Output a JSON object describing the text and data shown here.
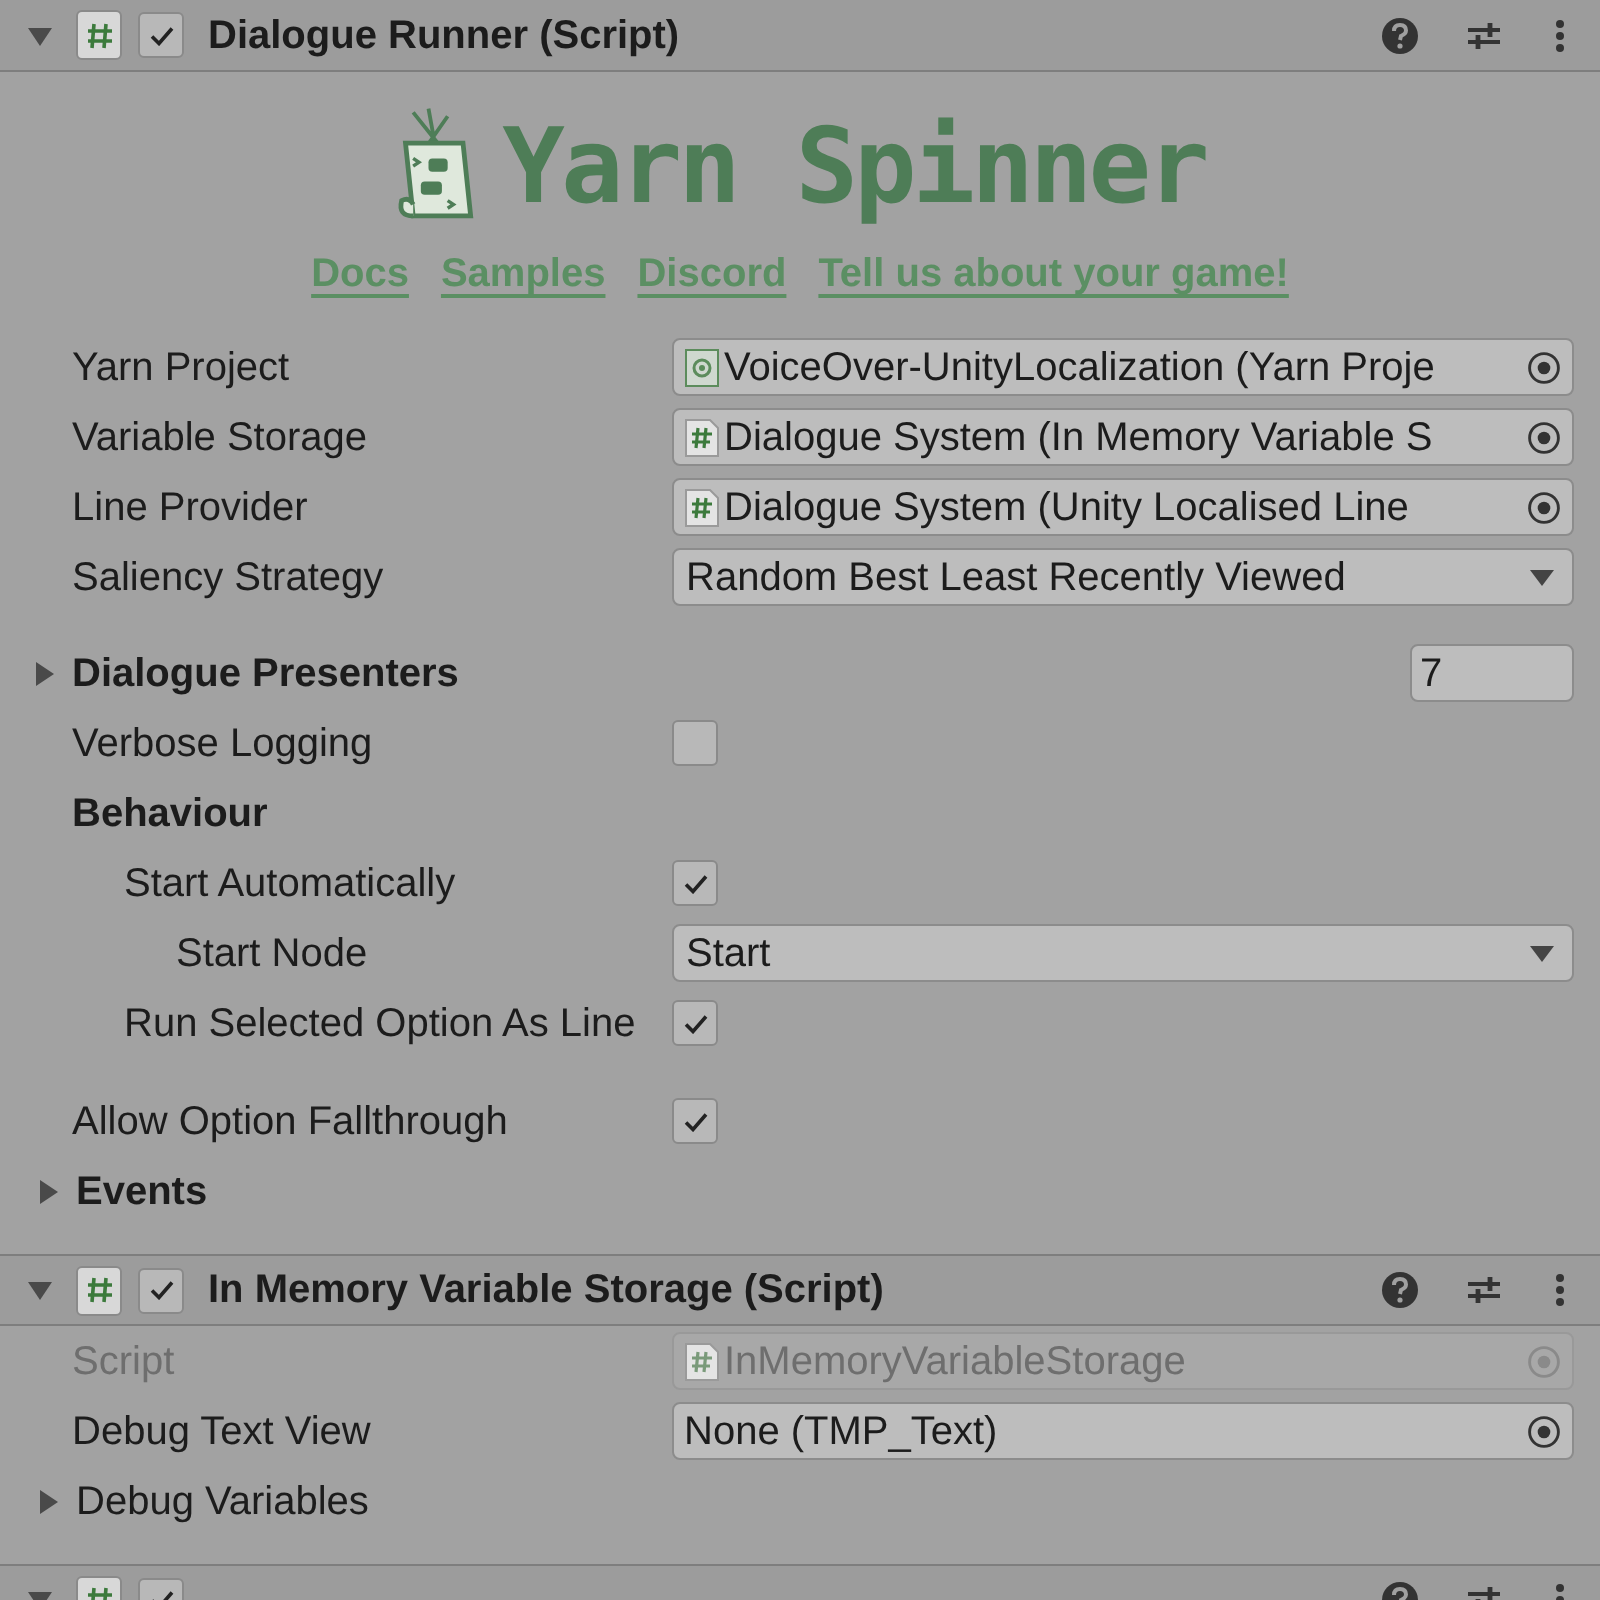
{
  "components": [
    {
      "title": "Dialogue Runner (Script)",
      "enabled": true,
      "expanded": true,
      "banner": {
        "name": "Yarn Spinner",
        "links": [
          "Docs",
          "Samples",
          "Discord",
          "Tell us about your game!"
        ]
      },
      "properties": [
        {
          "kind": "asset",
          "label": "Yarn Project",
          "value": "VoiceOver-UnityLocalization (Yarn Proje"
        },
        {
          "kind": "script",
          "label": "Variable Storage",
          "value": "Dialogue System (In Memory Variable S"
        },
        {
          "kind": "script",
          "label": "Line Provider",
          "value": "Dialogue System (Unity Localised Line"
        },
        {
          "kind": "dropdown",
          "label": "Saliency Strategy",
          "value": "Random Best Least Recently Viewed"
        },
        {
          "kind": "array",
          "label": "Dialogue Presenters",
          "expanded": false,
          "value": "7"
        },
        {
          "kind": "checkbox",
          "label": "Verbose Logging",
          "checked": false
        },
        {
          "kind": "group",
          "label": "Behaviour",
          "children": [
            {
              "kind": "checkbox",
              "label": "Start Automatically",
              "checked": true,
              "children": [
                {
                  "kind": "dropdown",
                  "label": "Start Node",
                  "value": "Start"
                }
              ]
            },
            {
              "kind": "checkbox",
              "label": "Run Selected Option As Line",
              "checked": true
            }
          ]
        },
        {
          "kind": "checkbox",
          "label": "Allow Option Fallthrough",
          "checked": true
        },
        {
          "kind": "foldout",
          "label": "Events",
          "expanded": false
        }
      ]
    },
    {
      "title": "In Memory Variable Storage (Script)",
      "enabled": true,
      "expanded": true,
      "properties": [
        {
          "kind": "script",
          "label": "Script",
          "value": "InMemoryVariableStorage",
          "disabled": true
        },
        {
          "kind": "object",
          "label": "Debug Text View",
          "value": "None (TMP_Text)"
        },
        {
          "kind": "foldout",
          "label": "Debug Variables",
          "expanded": false
        }
      ]
    },
    {
      "enabled": true,
      "expanded": true
    }
  ]
}
